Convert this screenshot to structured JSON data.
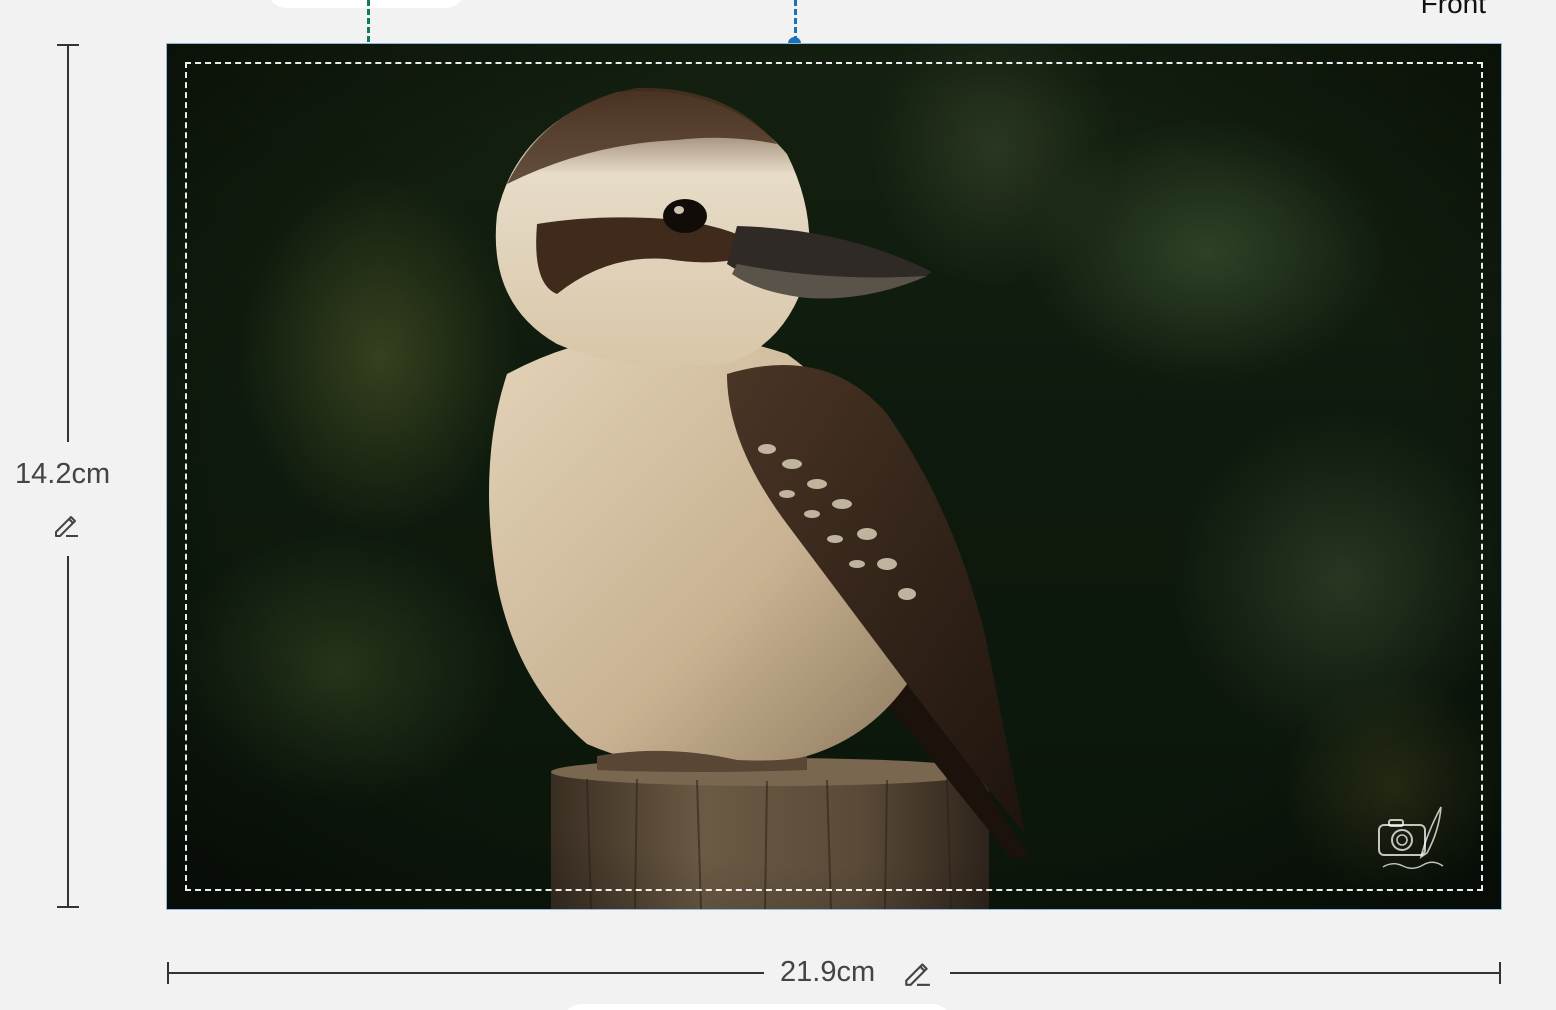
{
  "side_label": "Front",
  "dimensions": {
    "height": "14.2cm",
    "width": "21.9cm"
  },
  "icons": {
    "height_edit": "pencil-icon",
    "width_edit": "pencil-icon",
    "watermark": "camera-feather-logo"
  },
  "colors": {
    "safe_area_guide": "#0f7a5f",
    "bleed_guide": "#1a73b8",
    "canvas_border": "#8fb8dd"
  }
}
